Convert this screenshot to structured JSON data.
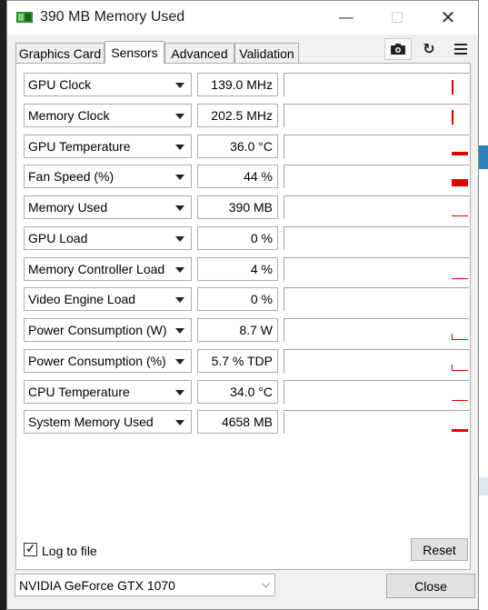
{
  "window": {
    "title": "390 MB Memory Used",
    "controls": {
      "minimize": "—",
      "maximize": "☐",
      "close": "✕"
    }
  },
  "tabs": [
    {
      "label": "Graphics Card",
      "active": false
    },
    {
      "label": "Sensors",
      "active": true
    },
    {
      "label": "Advanced",
      "active": false
    },
    {
      "label": "Validation",
      "active": false
    }
  ],
  "toolbar": {
    "icons": [
      "camera-icon",
      "refresh-icon",
      "menu-icon"
    ]
  },
  "sensors": [
    {
      "name": "GPU Clock",
      "value": "139.0 MHz"
    },
    {
      "name": "Memory Clock",
      "value": "202.5 MHz"
    },
    {
      "name": "GPU Temperature",
      "value": "36.0 °C"
    },
    {
      "name": "Fan Speed (%)",
      "value": "44 %"
    },
    {
      "name": "Memory Used",
      "value": "390 MB"
    },
    {
      "name": "GPU Load",
      "value": "0 %"
    },
    {
      "name": "Memory Controller Load",
      "value": "4 %"
    },
    {
      "name": "Video Engine Load",
      "value": "0 %"
    },
    {
      "name": "Power Consumption (W)",
      "value": "8.7 W"
    },
    {
      "name": "Power Consumption (%)",
      "value": "5.7 % TDP"
    },
    {
      "name": "CPU Temperature",
      "value": "34.0 °C"
    },
    {
      "name": "System Memory Used",
      "value": "4658 MB"
    }
  ],
  "footer": {
    "log_to_file_label": "Log to file",
    "log_to_file_checked": true,
    "reset_label": "Reset",
    "gpu_select_value": "NVIDIA GeForce GTX 1070",
    "close_label": "Close"
  },
  "colors": {
    "graph_line": "#e00000"
  }
}
